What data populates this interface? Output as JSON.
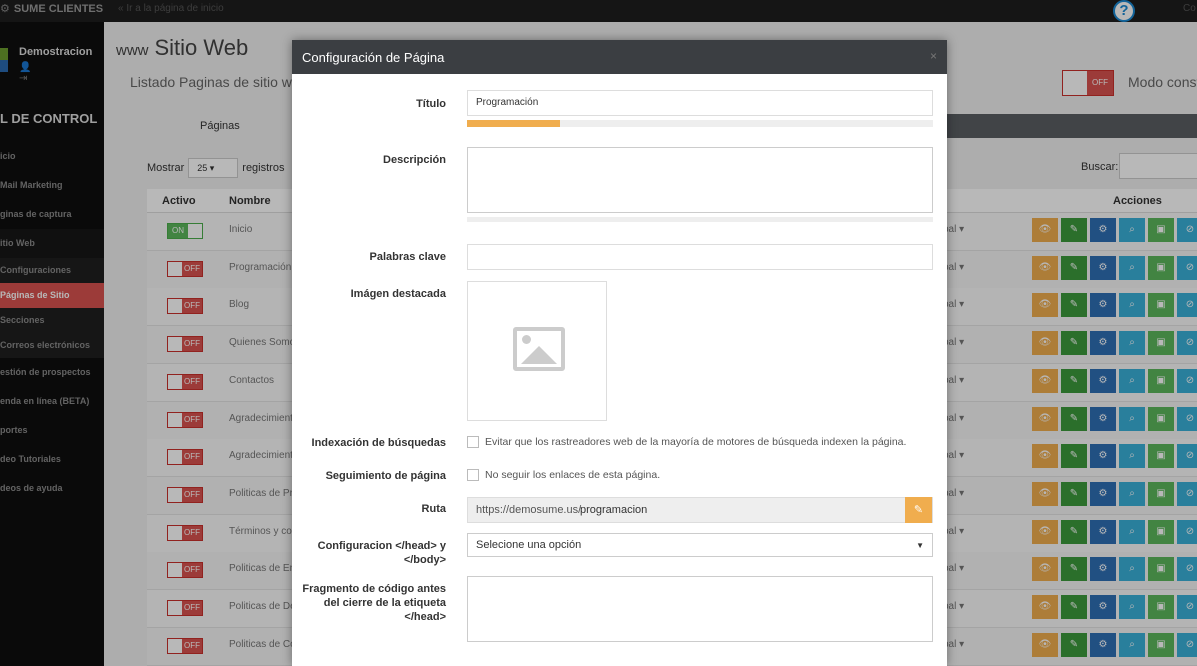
{
  "topbar": {
    "brand": "SUME CLIENTES",
    "back_link": "« Ir a la página de inicio",
    "help": "?",
    "right": "Co"
  },
  "sidebar": {
    "user_name": "Demostracion",
    "user_icons": "👤 ⇥",
    "panel_title": "L DE CONTROL",
    "items": [
      "icio",
      "Mail Marketing",
      "ginas de captura",
      "itio Web",
      "Configuraciones",
      "Páginas de Sitio",
      "Secciones",
      "Correos electrónicos",
      "estión de prospectos",
      "enda en línea (BETA)",
      "portes",
      "deo Tutoriales",
      "deos de ayuda"
    ]
  },
  "page": {
    "www": "www",
    "title": "Sitio Web",
    "subtitle": "Listado Paginas de sitio web",
    "toggle_off": "OFF",
    "modo_label": "Modo consti",
    "tab_pages": "Páginas",
    "mostrar": "Mostrar",
    "mostrar_value": "25",
    "registros": "registros",
    "buscar": "Buscar:",
    "headers": {
      "activo": "Activo",
      "nombre": "Nombre",
      "acciones": "Acciones"
    },
    "rows": [
      {
        "state": "ON",
        "name": "Inicio",
        "sel": "pal"
      },
      {
        "state": "OFF",
        "name": "Programación",
        "sel": "pal"
      },
      {
        "state": "OFF",
        "name": "Blog",
        "sel": "pal"
      },
      {
        "state": "OFF",
        "name": "Quienes Somo",
        "sel": "pal"
      },
      {
        "state": "OFF",
        "name": "Contactos",
        "sel": "pal"
      },
      {
        "state": "OFF",
        "name": "Agradecimient",
        "sel": "pal"
      },
      {
        "state": "OFF",
        "name": "Agradecimient",
        "sel": "pal"
      },
      {
        "state": "OFF",
        "name": "Politicas de Pr",
        "sel": "pal"
      },
      {
        "state": "OFF",
        "name": "Términos y co",
        "sel": "pal"
      },
      {
        "state": "OFF",
        "name": "Politicas de En",
        "sel": "pal"
      },
      {
        "state": "OFF",
        "name": "Politicas de De",
        "sel": "pal"
      },
      {
        "state": "OFF",
        "name": "Politicas de Co",
        "sel": "pal"
      }
    ]
  },
  "modal": {
    "title": "Configuración de Página",
    "close": "×",
    "titulo_label": "Título",
    "titulo_value": "Programación",
    "titulo_progress": 0.2,
    "descripcion_label": "Descripción",
    "palabras_label": "Palabras clave",
    "imagen_label": "Imágen destacada",
    "indexacion_label": "Indexación de búsquedas",
    "indexacion_text": "Evitar que los rastreadores web de la mayoría de motores de búsqueda indexen la página.",
    "seguimiento_label": "Seguimiento de página",
    "seguimiento_text": "No seguir los enlaces de esta página.",
    "ruta_label": "Ruta",
    "ruta_prefix": "https://demosume.us/",
    "ruta_slug": "programacion",
    "config_label": "Configuracion </head> y </body>",
    "config_value": "Selecione una opción",
    "fragmento_label": "Fragmento de código antes del cierre de la etiqueta </head>"
  }
}
